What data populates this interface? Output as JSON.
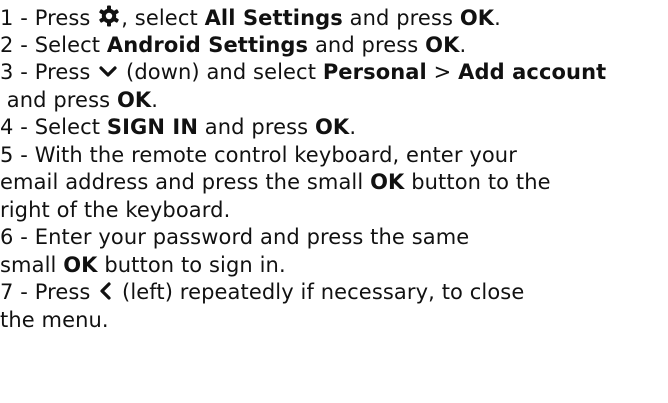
{
  "steps": [
    {
      "num": "1 - ",
      "pre": "Press ",
      "icon": "gear-icon",
      "mid1": ", select ",
      "b1": "All Settings",
      "mid2": " and press ",
      "b2": "OK",
      "end": "."
    },
    {
      "num": "2 - ",
      "pre": "Select ",
      "b1": "Android Settings",
      "mid1": " and press ",
      "b2": "OK",
      "end": "."
    },
    {
      "num": "3 - ",
      "pre": "Press ",
      "icon": "chevron-down-icon",
      "mid1": " (down) and select ",
      "b1": "Personal",
      "mid2": " > ",
      "b2": "Add account",
      "mid3": " and press ",
      "b3": "OK",
      "end": "."
    },
    {
      "num": "4 - ",
      "pre": "Select ",
      "b1": "SIGN IN",
      "mid1": " and press ",
      "b2": "OK",
      "end": "."
    },
    {
      "num": "5 - ",
      "pre": "With the remote control keyboard, enter your",
      "pre2": "email address and press the small ",
      "b1": "OK",
      "mid1": " button to the",
      "line3": "right of the keyboard."
    },
    {
      "num": "6 - ",
      "pre": "Enter your password and press the same",
      "pre2": "small ",
      "b1": "OK",
      "mid1": " button to sign in."
    },
    {
      "num": "7 - ",
      "pre": "Press ",
      "icon": "chevron-left-icon",
      "mid1": " (left) repeatedly if necessary, to close",
      "line2": "the menu."
    }
  ]
}
